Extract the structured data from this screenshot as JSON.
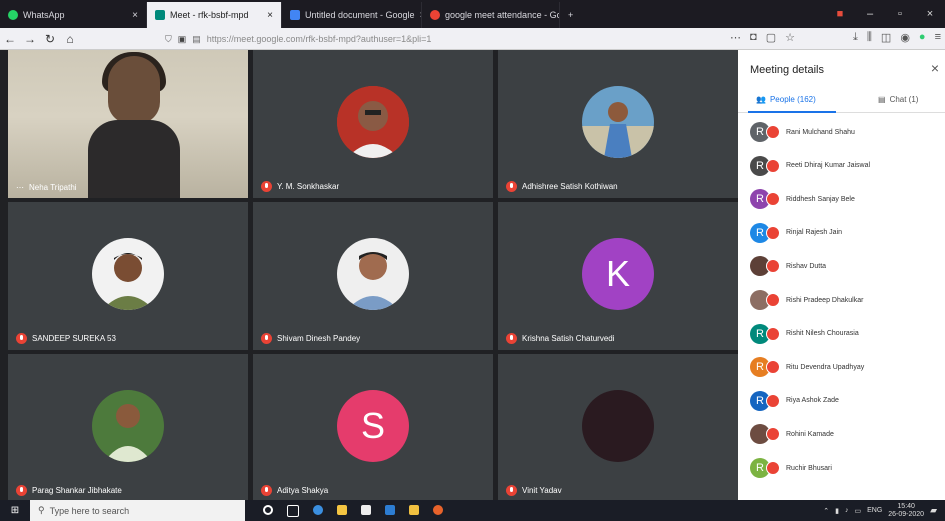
{
  "browser": {
    "tabs": [
      {
        "label": "WhatsApp",
        "color": "#25d366"
      },
      {
        "label": "Meet - rfk-bsbf-mpd",
        "color": "#00897b"
      },
      {
        "label": "Untitled document - Google",
        "color": "#4285f4"
      },
      {
        "label": "google meet attendance - Go",
        "color": "#ea4335"
      }
    ],
    "new_tab": "+",
    "url_host": "https://meet.google.com/",
    "url_path": "rfk-bsbf-mpd?authuser=1&pli=1"
  },
  "meeting": {
    "tiles": [
      {
        "name": "Neha Tripathi",
        "type": "video"
      },
      {
        "name": "Y. M. Sonkhaskar",
        "type": "photo",
        "color": "#c0392b"
      },
      {
        "name": "Adhishree Satish Kothiwan",
        "type": "photo",
        "color": "#3b6ea5"
      },
      {
        "name": "SANDEEP SUREKA 53",
        "type": "photo",
        "color": "#f0f0f0"
      },
      {
        "name": "Shivam Dinesh Pandey",
        "type": "photo",
        "color": "#eeeeee"
      },
      {
        "name": "Krishna Satish Chaturvedi",
        "type": "letter",
        "letter": "K",
        "color": "#a142c4"
      },
      {
        "name": "Parag Shankar Jibhakate",
        "type": "photo",
        "color": "#5c8a4a"
      },
      {
        "name": "Aditya Shakya",
        "type": "letter",
        "letter": "S",
        "color": "#e53c6c"
      },
      {
        "name": "Vinit Yadav",
        "type": "photo",
        "color": "#2a1a20"
      }
    ]
  },
  "panel": {
    "title": "Meeting details",
    "people_tab": "People (162)",
    "chat_tab": "Chat (1)",
    "people": [
      {
        "name": "Rani Mulchand Shahu",
        "letter": "R",
        "color": "#5f6368"
      },
      {
        "name": "Reeti Dhiraj Kumar Jaiswal",
        "letter": "R",
        "color": "#4a4a4a"
      },
      {
        "name": "Riddhesh Sanjay Bele",
        "letter": "R",
        "color": "#8e44ad"
      },
      {
        "name": "Rinjal Rajesh Jain",
        "letter": "R",
        "color": "#1e88e5"
      },
      {
        "name": "Rishav Dutta",
        "letter": "",
        "color": "#5d4037"
      },
      {
        "name": "Rishi Pradeep Dhakulkar",
        "letter": "",
        "color": "#8d6e63"
      },
      {
        "name": "Rishit Nilesh Chourasia",
        "letter": "R",
        "color": "#00897b"
      },
      {
        "name": "Ritu Devendra Upadhyay",
        "letter": "R",
        "color": "#e67e22"
      },
      {
        "name": "Riya Ashok Zade",
        "letter": "R",
        "color": "#1565c0"
      },
      {
        "name": "Rohini Kamade",
        "letter": "",
        "color": "#6d4c41"
      },
      {
        "name": "Ruchir Bhusari",
        "letter": "R",
        "color": "#7cb342"
      }
    ]
  },
  "taskbar": {
    "search_placeholder": "Type here to search",
    "lang": "ENG",
    "time": "15:40",
    "date": "26-09-2020"
  }
}
